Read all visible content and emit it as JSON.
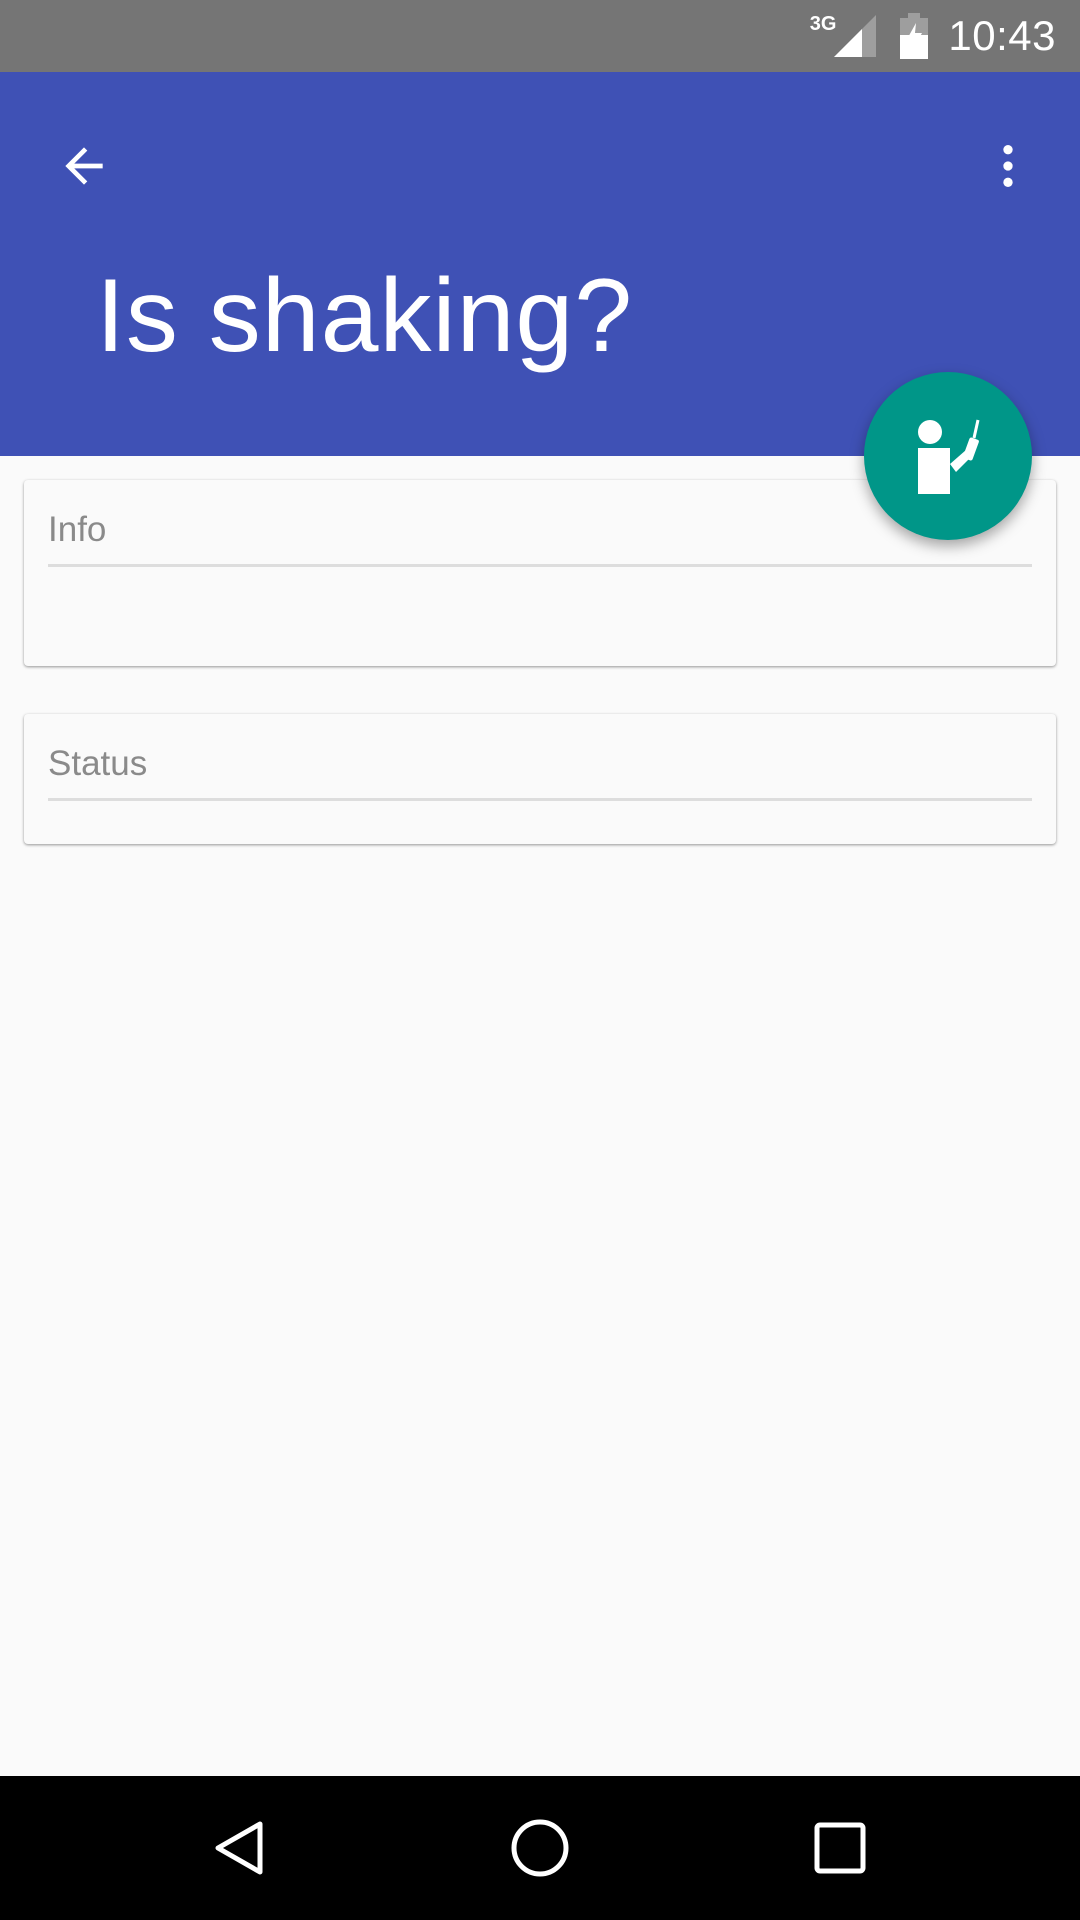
{
  "status_bar": {
    "network_type": "3G",
    "time": "10:43",
    "icons": [
      "signal-icon",
      "battery-charging-icon"
    ]
  },
  "app_bar": {
    "title": "Is shaking?",
    "back_icon": "arrow-back-icon",
    "overflow_icon": "more-vert-icon",
    "background_color": "#3F51B5"
  },
  "fab": {
    "icon": "person-with-phone-icon",
    "color": "#009688"
  },
  "cards": {
    "info": {
      "header": "Info"
    },
    "status": {
      "header": "Status"
    }
  },
  "nav_bar": {
    "icons": [
      "nav-back-icon",
      "nav-home-icon",
      "nav-recents-icon"
    ]
  }
}
